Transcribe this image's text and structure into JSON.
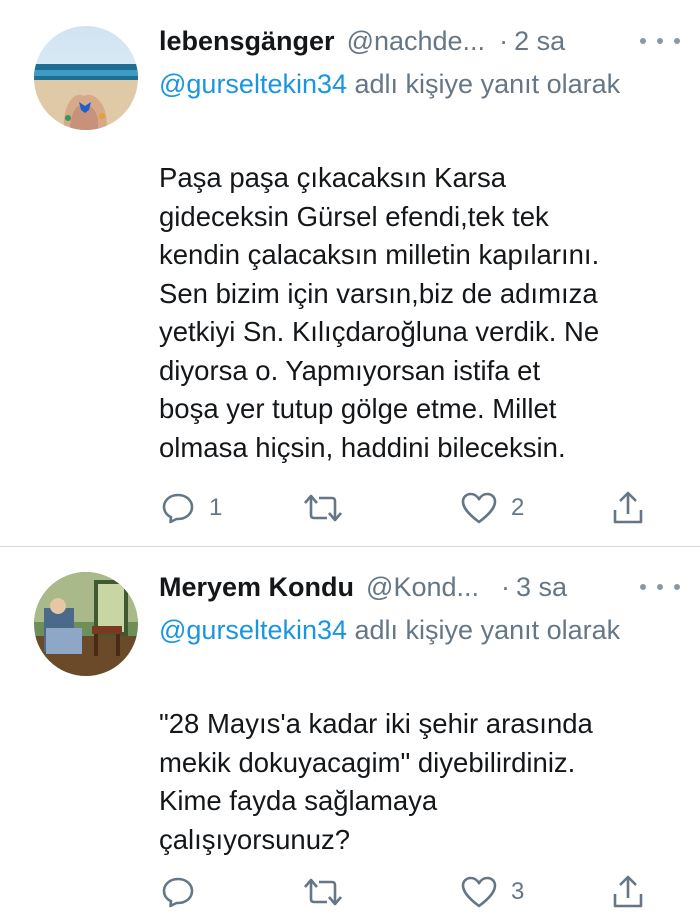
{
  "tweets": [
    {
      "user": {
        "name": "lebensgänger",
        "handle": "@nachde...",
        "time": "2 sa"
      },
      "reply": {
        "mention": "@gurseltekin34",
        "text": " adlı kişiye yanıt olarak"
      },
      "body": "Paşa paşa çıkacaksın Karsa\ngideceksin Gürsel efendi,tek tek\nkendin çalacaksın milletin kapılarını.\nSen bizim için varsın,biz de adımıza\nyetkiyi Sn. Kılıçdaroğluna verdik. Ne\ndiyorsa o. Yapmıyorsan istifa et\nboşa yer tutup gölge etme. Millet\nolmasa hiçsin, haddini bileceksin.",
      "actions": {
        "reply_count": "1",
        "retweet_count": "",
        "like_count": "2"
      },
      "icons": {
        "reply": "comment-icon",
        "retweet": "retweet-icon",
        "like": "heart-icon",
        "share": "share-icon",
        "more": "more-icon"
      }
    },
    {
      "user": {
        "name": "Meryem Kondu",
        "handle": "@Kond...",
        "time": "3 sa"
      },
      "reply": {
        "mention": "@gurseltekin34",
        "text": " adlı kişiye yanıt olarak"
      },
      "body": "\"28 Mayıs'a kadar iki şehir arasında\nmekik dokuyacagim\" diyebilirdiniz.\nKime fayda sağlamaya\nçalışıyorsunuz?",
      "actions": {
        "reply_count": "",
        "retweet_count": "",
        "like_count": "3"
      },
      "icons": {
        "reply": "comment-icon",
        "retweet": "retweet-icon",
        "like": "heart-icon",
        "share": "share-icon",
        "more": "more-icon"
      }
    }
  ],
  "colors": {
    "text": "#14171a",
    "secondary": "#657786",
    "link": "#1b95e0",
    "divider": "#d6dadd",
    "icon": "#657786"
  },
  "separator": "·"
}
